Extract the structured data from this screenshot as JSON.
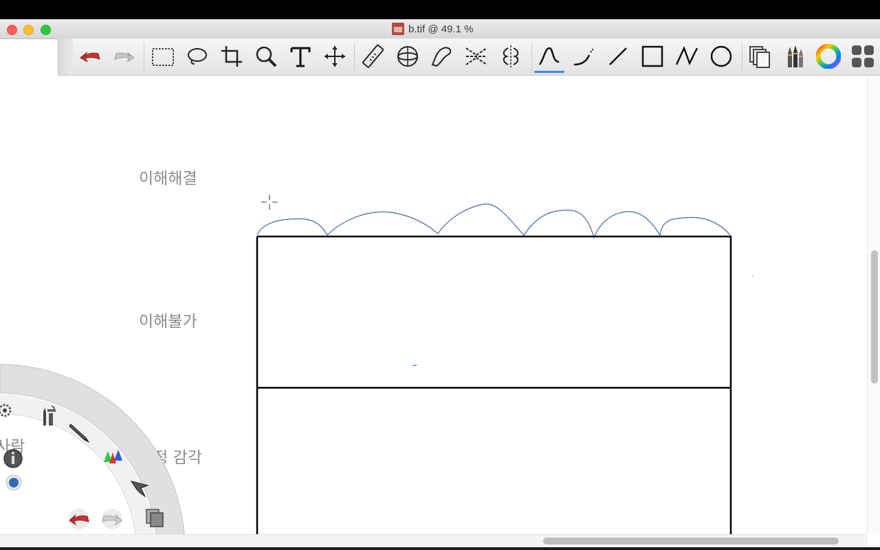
{
  "window": {
    "title": "b.tif @ 49.1 %"
  },
  "toolbar": {
    "tools": [
      {
        "name": "undo-icon"
      },
      {
        "name": "redo-icon"
      },
      {
        "name": "rect-select-icon"
      },
      {
        "name": "lasso-icon"
      },
      {
        "name": "crop-icon"
      },
      {
        "name": "zoom-icon"
      },
      {
        "name": "text-icon",
        "glyph": "T"
      },
      {
        "name": "move-icon"
      },
      {
        "name": "ruler-icon"
      },
      {
        "name": "ellipse-guide-icon"
      },
      {
        "name": "french-curve-icon"
      },
      {
        "name": "perspective-icon"
      },
      {
        "name": "symmetry-icon"
      },
      {
        "name": "freehand-line-icon",
        "active": true
      },
      {
        "name": "curve-line-icon"
      },
      {
        "name": "straight-line-icon"
      },
      {
        "name": "rectangle-icon"
      },
      {
        "name": "polyline-icon"
      },
      {
        "name": "circle-icon"
      },
      {
        "name": "layers-icon"
      },
      {
        "name": "brushes-icon"
      },
      {
        "name": "color-wheel-icon"
      },
      {
        "name": "panels-icon"
      }
    ],
    "active_color": "#3b8ed8"
  },
  "canvas": {
    "labels": [
      {
        "id": "label-1",
        "text": "이해해결"
      },
      {
        "id": "label-2",
        "text": "이해불가"
      },
      {
        "id": "label-3",
        "text": "감정 감각"
      },
      {
        "id": "label-4",
        "text": "사람"
      }
    ],
    "stroke_color": "#3f6d9e",
    "line_color": "#000000"
  },
  "lagoon": {
    "tools": [
      {
        "name": "settings-icon"
      },
      {
        "name": "toolbox-icon"
      },
      {
        "name": "pencil-icon"
      },
      {
        "name": "color-cones-icon"
      },
      {
        "name": "info-icon"
      },
      {
        "name": "brush-size-dot-icon"
      },
      {
        "name": "pointer-icon"
      },
      {
        "name": "undo-icon"
      },
      {
        "name": "redo-icon"
      },
      {
        "name": "copy-icon"
      }
    ]
  }
}
